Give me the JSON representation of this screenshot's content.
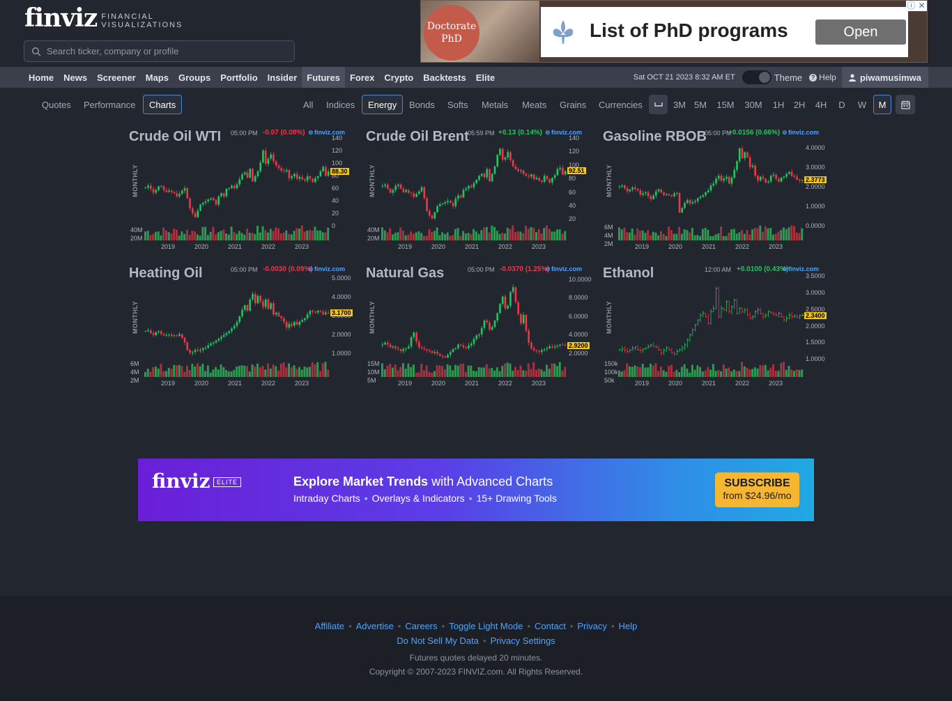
{
  "header": {
    "logo_main": "finviz",
    "logo_sub_1": "FINANCIAL",
    "logo_sub_2": "VISUALIZATIONS",
    "search_placeholder": "Search ticker, company or profile"
  },
  "ad_top": {
    "photo_text_1": "Doctorate",
    "photo_text_2": "PhD",
    "title": "List of PhD programs",
    "button": "Open"
  },
  "nav": {
    "items": [
      "Home",
      "News",
      "Screener",
      "Maps",
      "Groups",
      "Portfolio",
      "Insider",
      "Futures",
      "Forex",
      "Crypto",
      "Backtests",
      "Elite"
    ],
    "active": "Futures",
    "datetime": "Sat OCT 21 2023 8:32 AM ET",
    "theme_label": "Theme",
    "help_label": "Help",
    "username": "piwamusimwa"
  },
  "subtabs": {
    "views": [
      "Quotes",
      "Performance",
      "Charts"
    ],
    "active_view": "Charts",
    "groups": [
      "All",
      "Indices",
      "Energy",
      "Bonds",
      "Softs",
      "Metals",
      "Meats",
      "Grains",
      "Currencies"
    ],
    "active_group": "Energy",
    "timeframes": [
      "5M",
      "15M",
      "30M",
      "1H",
      "2H",
      "4H",
      "D",
      "W",
      "M"
    ],
    "partial_timeframe": "3M",
    "active_timeframe": "M"
  },
  "colors": {
    "up": "#22c55e",
    "down": "#f23645",
    "vol_up": "#2f9a54",
    "vol_down": "#a8323e",
    "accent": "#3f8ad9",
    "last_badge": "#f5c518"
  },
  "charts": [
    {
      "title": "Crude Oil WTI",
      "time": "05:00 PM",
      "change": "-0.07 (0.08%)",
      "direction": "neg",
      "brand": "finviz.com",
      "period": "MONTHLY",
      "y_ticks": [
        "140",
        "120",
        "100",
        "80",
        "60",
        "40",
        "20",
        "0"
      ],
      "y_tick_values": [
        140,
        120,
        100,
        80,
        60,
        40,
        20,
        0
      ],
      "ylim": [
        0,
        140
      ],
      "last": "88.30",
      "last_value": 88.3,
      "vol_ticks": [
        "40M",
        "20M"
      ],
      "x_ticks": [
        "2019",
        "2020",
        "2021",
        "2022",
        "2023"
      ],
      "style": "candle",
      "series": [
        62,
        65,
        60,
        54,
        58,
        64,
        64,
        58,
        55,
        57,
        55,
        53,
        48,
        52,
        57,
        61,
        45,
        29,
        21,
        15,
        25,
        35,
        38,
        40,
        43,
        45,
        42,
        35,
        48,
        53,
        48,
        60,
        61,
        65,
        61,
        67,
        75,
        83,
        86,
        78,
        92,
        72,
        80,
        88,
        102,
        121,
        100,
        108,
        115,
        104,
        97,
        93,
        89,
        88,
        90,
        77,
        80,
        84,
        76,
        79,
        75,
        73,
        80,
        76,
        71,
        77,
        80,
        88,
        95,
        81,
        88
      ]
    },
    {
      "title": "Crude Oil Brent",
      "time": "05:59 PM",
      "change": "+0.13 (0.14%)",
      "direction": "pos",
      "brand": "finviz.com",
      "period": "MONTHLY",
      "y_ticks": [
        "140",
        "120",
        "100",
        "80",
        "60",
        "40",
        "20"
      ],
      "y_tick_values": [
        140,
        120,
        100,
        80,
        60,
        40,
        20
      ],
      "ylim": [
        10,
        140
      ],
      "last": "92.51",
      "last_value": 92.51,
      "vol_ticks": [
        "40M",
        "20M"
      ],
      "x_ticks": [
        "2019",
        "2020",
        "2021",
        "2022",
        "2023"
      ],
      "style": "candle",
      "series": [
        70,
        72,
        66,
        60,
        64,
        70,
        72,
        66,
        61,
        64,
        60,
        59,
        54,
        58,
        62,
        68,
        52,
        33,
        26,
        22,
        31,
        40,
        43,
        44,
        46,
        48,
        45,
        40,
        51,
        56,
        53,
        64,
        66,
        70,
        68,
        74,
        79,
        85,
        88,
        83,
        95,
        77,
        88,
        99,
        116,
        125,
        109,
        112,
        120,
        108,
        99,
        95,
        92,
        93,
        88,
        85,
        84,
        87,
        80,
        82,
        78,
        76,
        85,
        80,
        75,
        82,
        86,
        95,
        97,
        87,
        92
      ]
    },
    {
      "title": "Gasoline RBOB",
      "time": "05:00 PM",
      "change": "+0.0156 (0.66%)",
      "direction": "pos",
      "brand": "finviz.com",
      "period": "MONTHLY",
      "y_ticks": [
        "4.0000",
        "3.0000",
        "2.0000",
        "1.0000",
        "0.0000"
      ],
      "y_tick_values": [
        4,
        3,
        2,
        1,
        0
      ],
      "ylim": [
        0,
        4.5
      ],
      "last": "2.3773",
      "last_value": 2.3773,
      "vol_ticks": [
        "6M",
        "4M",
        "2M"
      ],
      "x_ticks": [
        "2019",
        "2020",
        "2021",
        "2022",
        "2023"
      ],
      "style": "candle",
      "series": [
        2.05,
        2.1,
        1.95,
        1.8,
        1.9,
        2.0,
        1.92,
        1.85,
        1.62,
        1.7,
        1.75,
        1.55,
        1.4,
        1.58,
        1.8,
        1.9,
        1.75,
        1.62,
        1.65,
        1.6,
        1.55,
        1.7,
        1.72,
        0.72,
        0.95,
        1.2,
        1.35,
        1.18,
        1.25,
        1.3,
        1.45,
        1.52,
        1.6,
        1.75,
        1.85,
        2.1,
        2.2,
        2.45,
        2.6,
        2.35,
        2.45,
        2.55,
        2.2,
        2.5,
        2.9,
        3.35,
        4.0,
        3.5,
        3.8,
        3.55,
        3.05,
        3.12,
        2.6,
        2.35,
        2.55,
        2.45,
        2.25,
        2.3,
        2.6,
        2.65,
        2.45,
        2.3,
        2.5,
        2.55,
        2.7,
        2.8,
        2.6,
        2.55,
        2.4,
        2.35,
        2.38
      ]
    },
    {
      "title": "Heating Oil",
      "time": "05:00 PM",
      "change": "-0.0030 (0.09%)",
      "direction": "neg",
      "brand": "finviz.com",
      "period": "MONTHLY",
      "y_ticks": [
        "5.0000",
        "4.0000",
        "3.0000",
        "2.0000",
        "1.0000"
      ],
      "y_tick_values": [
        5,
        4,
        3,
        2,
        1
      ],
      "ylim": [
        0.5,
        5.2
      ],
      "last": "3.1700",
      "last_value": 3.17,
      "vol_ticks": [
        "6M",
        "4M",
        "2M"
      ],
      "x_ticks": [
        "2019",
        "2020",
        "2021",
        "2022",
        "2023"
      ],
      "style": "candle",
      "series": [
        2.2,
        2.25,
        2.1,
        2.0,
        2.15,
        2.2,
        2.05,
        1.98,
        2.0,
        2.02,
        1.95,
        1.98,
        1.95,
        2.05,
        1.85,
        1.6,
        1.2,
        1.05,
        1.1,
        1.2,
        1.15,
        1.2,
        1.3,
        1.32,
        1.45,
        1.55,
        1.6,
        1.7,
        1.8,
        1.9,
        2.0,
        2.1,
        2.2,
        2.35,
        2.5,
        2.7,
        3.0,
        3.35,
        3.6,
        3.3,
        3.9,
        4.2,
        3.7,
        4.1,
        3.8,
        3.5,
        3.9,
        3.4,
        3.7,
        3.1,
        3.2,
        3.0,
        2.9,
        2.7,
        2.4,
        2.6,
        2.5,
        2.7,
        2.55,
        2.7,
        2.8,
        2.9,
        3.1,
        3.3,
        3.25,
        3.2,
        3.3,
        3.25,
        3.1,
        3.2,
        3.17
      ]
    },
    {
      "title": "Natural Gas",
      "time": "05:00 PM",
      "change": "-0.0370 (1.25%)",
      "direction": "neg",
      "brand": "finviz.com",
      "period": "MONTHLY",
      "y_ticks": [
        "10.0000",
        "8.0000",
        "6.0000",
        "4.0000",
        "2.0000"
      ],
      "y_tick_values": [
        10,
        8,
        6,
        4,
        2
      ],
      "ylim": [
        1,
        10.5
      ],
      "last": "2.9200",
      "last_value": 2.92,
      "vol_ticks": [
        "15M",
        "10M",
        "5M"
      ],
      "x_ticks": [
        "2019",
        "2020",
        "2021",
        "2022",
        "2023"
      ],
      "style": "candle",
      "series": [
        3.0,
        3.2,
        3.0,
        2.7,
        2.8,
        2.6,
        2.5,
        2.3,
        2.5,
        2.6,
        2.8,
        3.8,
        4.3,
        3.3,
        2.7,
        2.6,
        2.5,
        2.4,
        2.3,
        2.1,
        2.2,
        2.0,
        1.8,
        1.7,
        1.6,
        1.9,
        2.2,
        2.5,
        2.6,
        3.0,
        2.9,
        2.7,
        2.6,
        2.9,
        3.1,
        3.6,
        4.0,
        4.1,
        4.8,
        5.6,
        5.4,
        4.6,
        4.9,
        5.6,
        6.4,
        7.4,
        8.2,
        6.9,
        7.2,
        8.7,
        9.2,
        7.6,
        6.3,
        5.3,
        6.2,
        4.5,
        3.2,
        2.6,
        2.4,
        2.3,
        2.2,
        2.4,
        2.5,
        2.6,
        2.8,
        2.7,
        2.8,
        2.9,
        3.0,
        2.95,
        2.92
      ]
    },
    {
      "title": "Ethanol",
      "time": "12:00 AM",
      "change": "+0.0100 (0.43%)",
      "direction": "pos",
      "brand": "finviz.com",
      "period": "MONTHLY",
      "y_ticks": [
        "3.5000",
        "3.0000",
        "2.5000",
        "2.0000",
        "1.5000",
        "1.0000"
      ],
      "y_tick_values": [
        3.5,
        3.0,
        2.5,
        2.0,
        1.5,
        1.0
      ],
      "ylim": [
        0.9,
        3.55
      ],
      "last": "2.3400",
      "last_value": 2.34,
      "vol_ticks": [
        "150k",
        "100k",
        "50k"
      ],
      "x_ticks": [
        "2019",
        "2020",
        "2021",
        "2022",
        "2023"
      ],
      "style": "ohlc",
      "series": [
        1.3,
        1.32,
        1.28,
        1.25,
        1.3,
        1.35,
        1.38,
        1.3,
        1.28,
        1.32,
        1.35,
        1.4,
        1.45,
        1.4,
        1.38,
        1.3,
        1.2,
        1.28,
        1.35,
        1.3,
        1.22,
        1.18,
        1.25,
        1.3,
        1.35,
        1.45,
        1.6,
        1.75,
        1.9,
        2.05,
        2.2,
        2.35,
        2.4,
        2.3,
        2.1,
        2.45,
        2.55,
        3.15,
        2.3,
        2.55,
        2.5,
        2.75,
        2.45,
        2.6,
        2.8,
        2.4,
        2.55,
        2.45,
        2.5,
        2.35,
        2.25,
        2.3,
        2.45,
        2.5,
        2.4,
        2.3,
        2.35,
        2.45,
        2.42,
        2.38,
        2.35,
        2.4,
        2.3,
        2.2,
        2.25,
        2.35,
        2.3,
        2.32,
        2.28,
        2.33,
        2.34
      ]
    }
  ],
  "banner": {
    "logo": "finviz",
    "elite": "ELITE",
    "headline_bold": "Explore Market Trends",
    "headline_rest": "with Advanced Charts",
    "features": [
      "Intraday Charts",
      "Overlays & Indicators",
      "15+ Drawing Tools"
    ],
    "cta_main": "SUBSCRIBE",
    "cta_sub": "from $24.96/mo"
  },
  "footer": {
    "links_row1": [
      "Affiliate",
      "Advertise",
      "Careers",
      "Toggle Light Mode",
      "Contact",
      "Privacy",
      "Help"
    ],
    "links_row2": [
      "Do Not Sell My Data",
      "Privacy Settings"
    ],
    "delay_note": "Futures quotes delayed 20 minutes.",
    "copyright": "Copyright © 2007-2023 FINVIZ.com. All Rights Reserved."
  }
}
